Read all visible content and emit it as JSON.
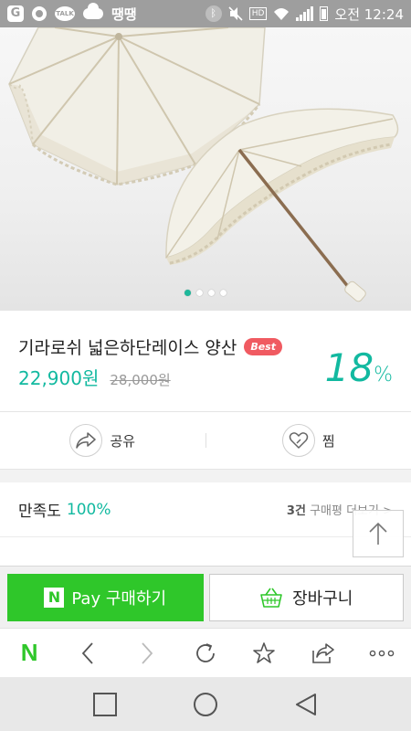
{
  "status_bar": {
    "time": "오전 12:24",
    "app_text": "땡땡",
    "talk_text": "TALK",
    "hd_text": "HD",
    "g_text": "G"
  },
  "hero": {
    "slides": 4,
    "active_slide": 1
  },
  "product": {
    "name": "기라로쉬 넓은하단레이스 양산",
    "badge": "Best",
    "price": "22,900원",
    "original_price": "28,000원",
    "discount": "18",
    "discount_unit": "%"
  },
  "actions": {
    "share_label": "공유",
    "wish_label": "찜"
  },
  "satisfaction": {
    "label": "만족도",
    "value": "100%",
    "review_count": "3건",
    "review_link": "구매평 더보기 >"
  },
  "buy_bar": {
    "pay_logo": "N",
    "pay_label": "Pay 구매하기",
    "cart_label": "장바구니"
  },
  "toolbar": {
    "logo": "N"
  },
  "colors": {
    "accent": "#12b9a0",
    "pay_green": "#2fc72a",
    "badge_red": "#f05a61"
  }
}
